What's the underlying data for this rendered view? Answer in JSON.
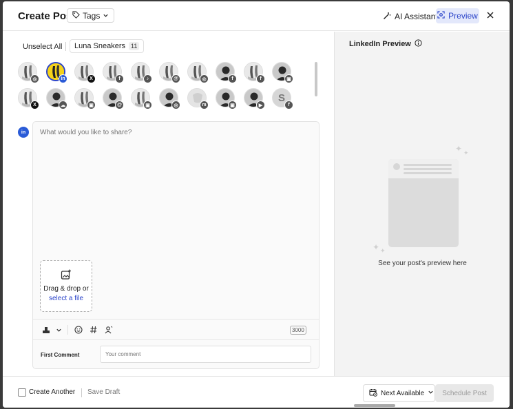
{
  "header": {
    "title": "Create Post",
    "tags_label": "Tags",
    "ai_label": "AI Assistant",
    "preview_label": "Preview"
  },
  "accounts": {
    "unselect_label": "Unselect All",
    "group_label": "Luna Sneakers",
    "group_count": "11",
    "items": [
      {
        "avatar": "photo",
        "platform": "instagram",
        "selected": false
      },
      {
        "avatar": "yellow",
        "platform": "linkedin",
        "selected": true
      },
      {
        "avatar": "photo",
        "platform": "x",
        "selected": false
      },
      {
        "avatar": "photo",
        "platform": "facebook",
        "selected": false
      },
      {
        "avatar": "photo",
        "platform": "tiktok",
        "selected": false
      },
      {
        "avatar": "photo",
        "platform": "threads",
        "selected": false
      },
      {
        "avatar": "photo",
        "platform": "instagram",
        "selected": false
      },
      {
        "avatar": "person",
        "platform": "facebook",
        "selected": false
      },
      {
        "avatar": "photo",
        "platform": "facebook",
        "selected": false
      },
      {
        "avatar": "person",
        "platform": "google-business",
        "selected": false
      },
      {
        "avatar": "photo",
        "platform": "x",
        "selected": false
      },
      {
        "avatar": "person",
        "platform": "bluesky",
        "selected": false
      },
      {
        "avatar": "photo",
        "platform": "google-business",
        "selected": false
      },
      {
        "avatar": "person",
        "platform": "threads",
        "selected": false
      },
      {
        "avatar": "photo",
        "platform": "google-business",
        "selected": false
      },
      {
        "avatar": "person",
        "platform": "instagram",
        "selected": false
      },
      {
        "avatar": "light",
        "platform": "mastodon",
        "selected": false
      },
      {
        "avatar": "person",
        "platform": "google-business",
        "selected": false
      },
      {
        "avatar": "person",
        "platform": "youtube",
        "selected": false
      },
      {
        "avatar": "letter",
        "letter": "S",
        "platform": "facebook",
        "selected": false
      }
    ]
  },
  "editor": {
    "placeholder": "What would you like to share?",
    "drop_text": "Drag & drop or",
    "drop_link": "select a file",
    "char_count": "3000",
    "first_comment_label": "First Comment",
    "comment_placeholder": "Your comment"
  },
  "preview": {
    "title": "LinkedIn Preview",
    "empty_text": "See your post's preview here"
  },
  "footer": {
    "create_another": "Create Another",
    "save_draft": "Save Draft",
    "next_available": "Next Available",
    "schedule": "Schedule Post"
  },
  "colors": {
    "accent": "#2b44c9",
    "linkedin": "#2a5bd7",
    "preview_bg": "#e3e8fb"
  }
}
